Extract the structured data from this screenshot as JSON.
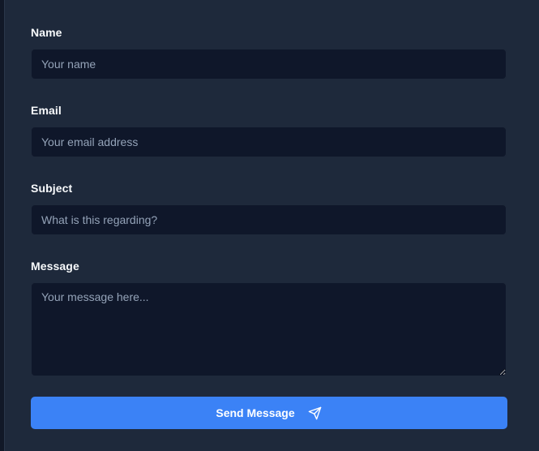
{
  "form": {
    "name": {
      "label": "Name",
      "placeholder": "Your name",
      "value": ""
    },
    "email": {
      "label": "Email",
      "placeholder": "Your email address",
      "value": ""
    },
    "subject": {
      "label": "Subject",
      "placeholder": "What is this regarding?",
      "value": ""
    },
    "message": {
      "label": "Message",
      "placeholder": "Your message here...",
      "value": ""
    },
    "submit": {
      "label": "Send Message",
      "icon": "send-icon"
    }
  },
  "colors": {
    "background": "#1e293b",
    "input_background": "#0f172a",
    "accent": "#3b82f6",
    "label_text": "#f8fafc",
    "placeholder_text": "#94a3b8"
  }
}
